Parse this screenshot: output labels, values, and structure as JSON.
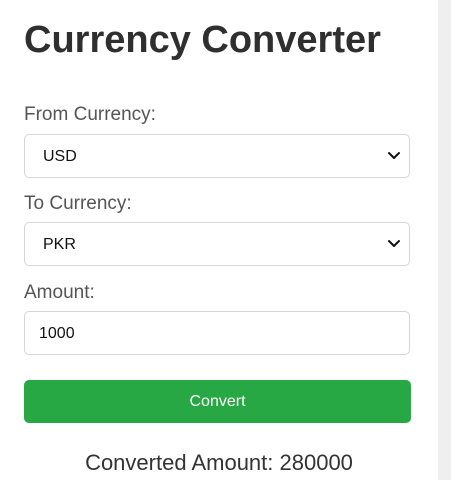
{
  "app": {
    "title": "Currency Converter"
  },
  "form": {
    "from_label": "From Currency:",
    "from_value": "USD",
    "to_label": "To Currency:",
    "to_value": "PKR",
    "amount_label": "Amount:",
    "amount_value": "1000",
    "convert_label": "Convert"
  },
  "result": {
    "text": "Converted Amount: 280000"
  },
  "icons": {
    "from_select": "chevron-down-icon",
    "to_select": "chevron-down-icon"
  },
  "colors": {
    "button": "#28a745",
    "title": "#2f2f2f",
    "label": "#555555",
    "border": "#d6d6d6",
    "right_rail": "#efefef"
  }
}
